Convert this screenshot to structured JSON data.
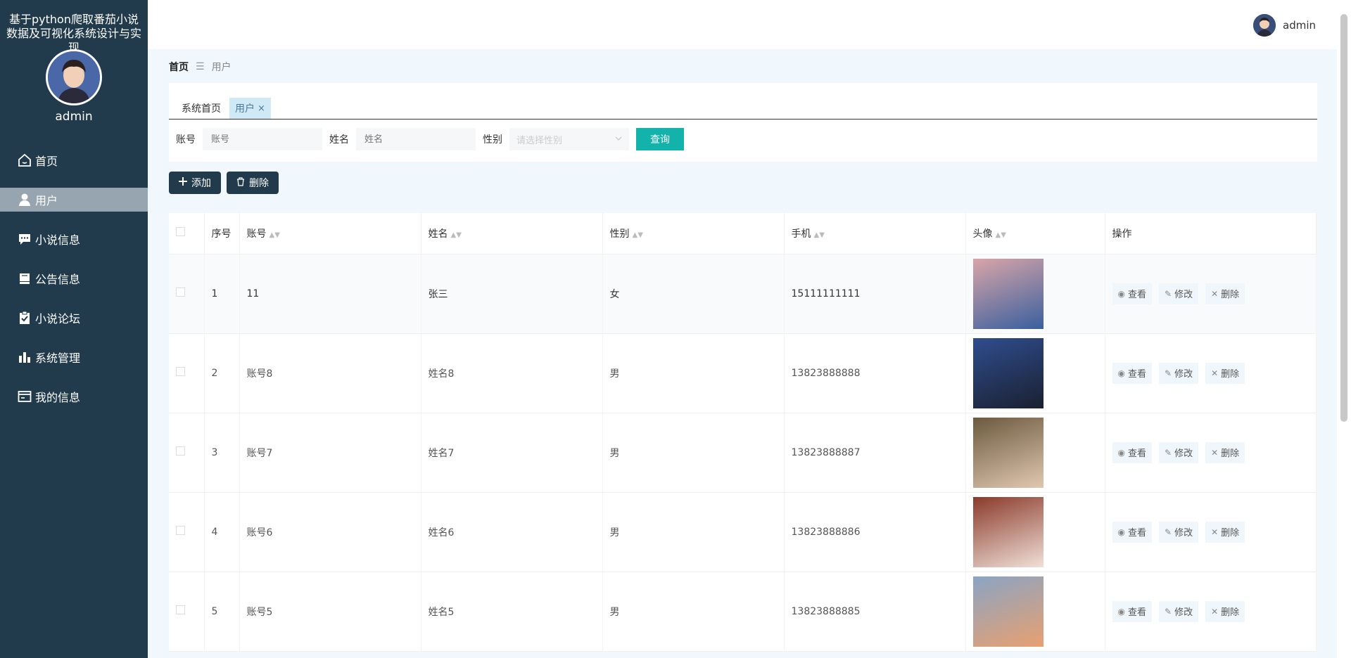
{
  "app": {
    "title": "基于python爬取番茄小说数据及可视化系统设计与实现",
    "username": "admin"
  },
  "sidebar": {
    "items": [
      {
        "label": "首页",
        "icon": "home-icon"
      },
      {
        "label": "用户",
        "icon": "user-icon",
        "active": true
      },
      {
        "label": "小说信息",
        "icon": "chat-icon"
      },
      {
        "label": "公告信息",
        "icon": "book-icon"
      },
      {
        "label": "小说论坛",
        "icon": "clipboard-check-icon"
      },
      {
        "label": "系统管理",
        "icon": "bar-chart-icon"
      },
      {
        "label": "我的信息",
        "icon": "id-card-icon"
      }
    ]
  },
  "topbar": {
    "username": "admin"
  },
  "breadcrumb": {
    "home": "首页",
    "separator": "☰",
    "current": "用户"
  },
  "tabs": [
    {
      "label": "系统首页"
    },
    {
      "label": "用户",
      "active": true,
      "close": "×"
    }
  ],
  "search": {
    "account_label": "账号",
    "account_placeholder": "账号",
    "name_label": "姓名",
    "name_placeholder": "姓名",
    "gender_label": "性别",
    "gender_placeholder": "请选择性别",
    "query_button": "查询"
  },
  "toolbar": {
    "add_label": "添加",
    "delete_label": "删除"
  },
  "table": {
    "headers": {
      "index": "序号",
      "account": "账号",
      "name": "姓名",
      "gender": "性别",
      "phone": "手机",
      "avatar": "头像",
      "ops": "操作"
    },
    "ops": {
      "view": "查看",
      "edit": "修改",
      "delete": "删除"
    },
    "rows": [
      {
        "index": "1",
        "account": "11",
        "name": "张三",
        "gender": "女",
        "phone": "15111111111",
        "photo_colors": [
          "#d9a5a8",
          "#3a5f9e"
        ]
      },
      {
        "index": "2",
        "account": "账号8",
        "name": "姓名8",
        "gender": "男",
        "phone": "13823888888",
        "photo_colors": [
          "#2f4d8e",
          "#1a2030"
        ]
      },
      {
        "index": "3",
        "account": "账号7",
        "name": "姓名7",
        "gender": "男",
        "phone": "13823888887",
        "photo_colors": [
          "#6b5a3e",
          "#e0c8b0"
        ]
      },
      {
        "index": "4",
        "account": "账号6",
        "name": "姓名6",
        "gender": "男",
        "phone": "13823888886",
        "photo_colors": [
          "#8a3a2a",
          "#f0e0d8"
        ]
      },
      {
        "index": "5",
        "account": "账号5",
        "name": "姓名5",
        "gender": "男",
        "phone": "13823888885",
        "photo_colors": [
          "#8aa4c4",
          "#e8a070"
        ]
      }
    ]
  }
}
